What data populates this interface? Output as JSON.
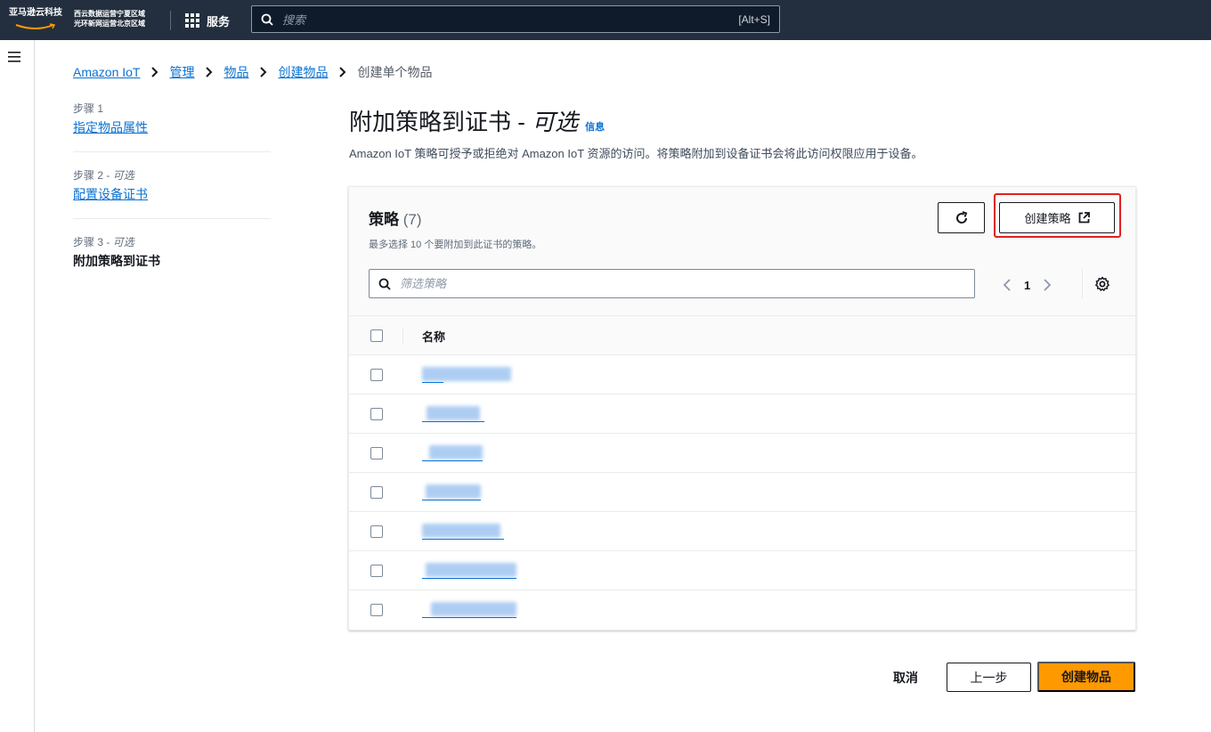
{
  "topbar": {
    "logo_text": "亚马逊云科技",
    "region_line1": "西云数据运营宁夏区域",
    "region_line2": "光环新网运营北京区域",
    "services_label": "服务",
    "search_placeholder": "搜索",
    "search_shortcut": "[Alt+S]"
  },
  "breadcrumb": {
    "items": [
      "Amazon IoT",
      "管理",
      "物品",
      "创建物品"
    ],
    "current": "创建单个物品"
  },
  "steps": [
    {
      "label": "步骤 1",
      "optional": "",
      "title": "指定物品属性"
    },
    {
      "label": "步骤 2 - ",
      "optional": "可选",
      "title": "配置设备证书"
    },
    {
      "label": "步骤 3 - ",
      "optional": "可选",
      "title": "附加策略到证书"
    }
  ],
  "page": {
    "title": "附加策略到证书 - ",
    "title_optional": "可选",
    "info": "信息",
    "description": "Amazon IoT 策略可授予或拒绝对 Amazon IoT 资源的访问。将策略附加到设备证书会将此访问权限应用于设备。"
  },
  "policies": {
    "title": "策略",
    "count": "(7)",
    "subtitle": "最多选择 10 个要附加到此证书的策略。",
    "create_button": "创建策略",
    "filter_placeholder": "筛选策略",
    "page_number": "1",
    "column_name": "名称",
    "rows": 7
  },
  "footer": {
    "cancel": "取消",
    "previous": "上一步",
    "create": "创建物品"
  },
  "colors": {
    "topbar": "#232f3e",
    "link": "#0972d3",
    "primary": "#ff9900",
    "highlight": "#e02020"
  }
}
